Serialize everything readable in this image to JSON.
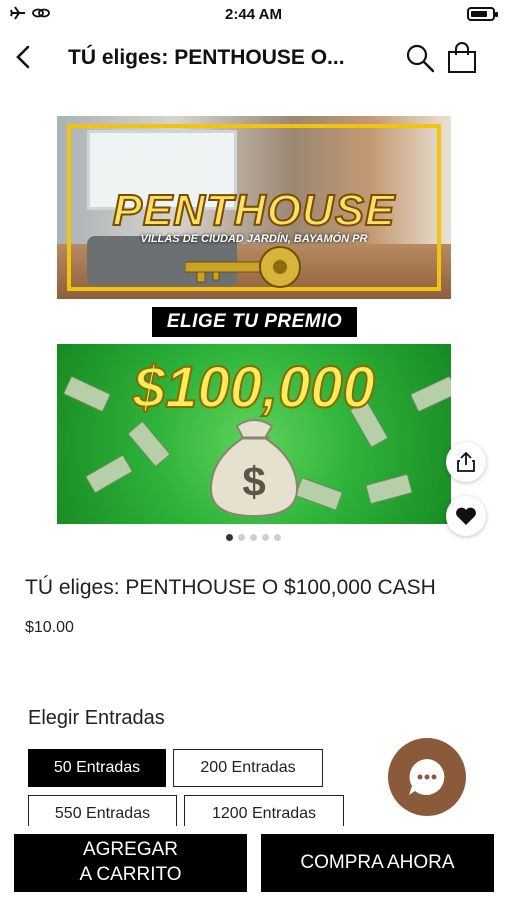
{
  "status_bar": {
    "time": "2:44 AM",
    "battery_level": 0.8
  },
  "header": {
    "title": "TÚ eliges: PENTHOUSE O..."
  },
  "gallery": {
    "penthouse_word": "PENTHOUSE",
    "penthouse_location": "VILLAS DE CIUDAD JARDÍN, BAYAMÓN PR",
    "ribbon": "ELIGE TU PREMIO",
    "cash_amount": "$100,000",
    "image_count": 5,
    "active_index": 0
  },
  "product": {
    "name": "TÚ eliges: PENTHOUSE O $100,000 CASH",
    "price": "$10.00"
  },
  "entries": {
    "label": "Elegir Entradas",
    "options": [
      "50 Entradas",
      "200 Entradas",
      "550 Entradas",
      "1200 Entradas"
    ],
    "selected": "50 Entradas"
  },
  "actions": {
    "add_to_cart": "AGREGAR\nA CARRITO",
    "buy_now": "COMPRA AHORA"
  },
  "colors": {
    "accent": "#000000",
    "chat_bubble": "#8a5a3a",
    "cash_green": "#2eb33a",
    "gold": "#f1c40f"
  }
}
